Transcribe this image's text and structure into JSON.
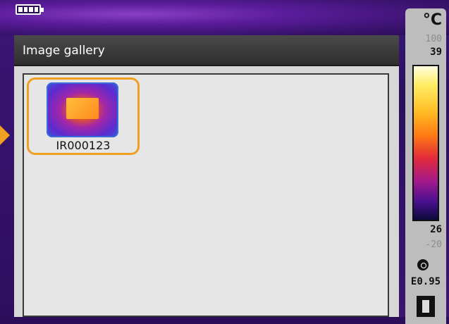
{
  "gallery": {
    "title": "Image gallery",
    "images": [
      {
        "label": "IR000123",
        "selected": true
      }
    ]
  },
  "scale": {
    "unit": "°C",
    "range_max": "100",
    "max": "39",
    "min": "26",
    "range_min": "-20",
    "emissivity": "E0.95"
  },
  "status": {
    "battery_icon": "battery-icon",
    "auto_icon": "auto-range-icon",
    "mode_icon": "mode-icon"
  },
  "colors": {
    "selection": "#f0a020",
    "header": "#3a3a3a"
  }
}
